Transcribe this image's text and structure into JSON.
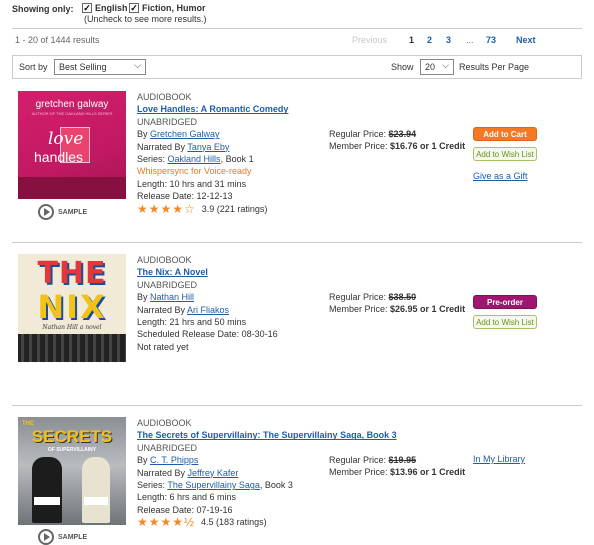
{
  "filters": {
    "showing_label": "Showing only:",
    "english": "English",
    "fiction": "Fiction, Humor",
    "uncheck_note": "(Uncheck to see more results.)"
  },
  "pager": {
    "count": "1 - 20 of 1444 results",
    "previous": "Previous",
    "pages": [
      "1",
      "2",
      "3"
    ],
    "ellipsis": "...",
    "last": "73",
    "next": "Next"
  },
  "sort": {
    "label": "Sort by",
    "value": "Best Selling",
    "show_label": "Show",
    "per_page_value": "20",
    "per_page_label": "Results Per Page"
  },
  "results": [
    {
      "format": "AUDIOBOOK",
      "title": "Love Handles: A Romantic Comedy",
      "edition": "UNABRIDGED",
      "by_label": "By",
      "author": "Gretchen Galway",
      "narrated_label": "Narrated By",
      "narrator": "Tanya Eby",
      "series_label": "Series:",
      "series": "Oakland Hills",
      "series_book": ", Book 1",
      "whispersync": "Whispersync for Voice-ready",
      "length": "Length:  10 hrs and 31 mins",
      "release": "Release Date:  12-12-13",
      "stars": "★★★★☆",
      "rating": 3.9,
      "rating_text": "3.9 (221 ratings)",
      "regular_label": "Regular Price:",
      "regular_price": "$23.94",
      "member_label": "Member Price:",
      "member_price": "$16.76 or 1 Credit",
      "primary_button": "Add to Cart",
      "wishlist_button": "Add to Wish List",
      "gift_link": "Give as a Gift",
      "sample_label": "SAMPLE",
      "cover": {
        "author": "gretchen galway",
        "tagline": "AUTHOR OF THE OAKLAND HILLS SERIES",
        "word1": "love",
        "word2": "handles"
      }
    },
    {
      "format": "AUDIOBOOK",
      "title": "The Nix: A Novel",
      "edition": "UNABRIDGED",
      "by_label": "By",
      "author": "Nathan Hill",
      "narrated_label": "Narrated By",
      "narrator": "Ari Fliakos",
      "length": "Length:  21 hrs and 50 mins",
      "release": "Scheduled Release Date:  08-30-16",
      "not_rated": "Not rated yet",
      "regular_label": "Regular Price:",
      "regular_price": "$38.50",
      "member_label": "Member Price:",
      "member_price": "$26.95 or 1 Credit",
      "primary_button": "Pre-order",
      "wishlist_button": "Add to Wish List",
      "cover": {
        "line1": "THE",
        "line2": "NIX",
        "byline": "Nathan Hill  a novel"
      }
    },
    {
      "format": "AUDIOBOOK",
      "title": "The Secrets of Supervillainy: The Supervillainy Saga, Book 3",
      "edition": "UNABRIDGED",
      "by_label": "By",
      "author": "C. T. Phipps",
      "narrated_label": "Narrated By",
      "narrator": "Jeffrey Kafer",
      "series_label": "Series:",
      "series": "The Supervillainy Saga",
      "series_book": ", Book 3",
      "length": "Length:  6 hrs and 6 mins",
      "release": "Release Date:  07-19-16",
      "stars": "★★★★½",
      "rating": 4.5,
      "rating_text": "4.5 (183 ratings)",
      "regular_label": "Regular Price:",
      "regular_price": "$19.95",
      "member_label": "Member Price:",
      "member_price": "$13.96 or 1 Credit",
      "library_link": "In My Library",
      "sample_label": "SAMPLE",
      "cover": {
        "title1": "THE",
        "title2": "SECRETS",
        "title3": "OF SUPERVILLAINY"
      }
    }
  ]
}
